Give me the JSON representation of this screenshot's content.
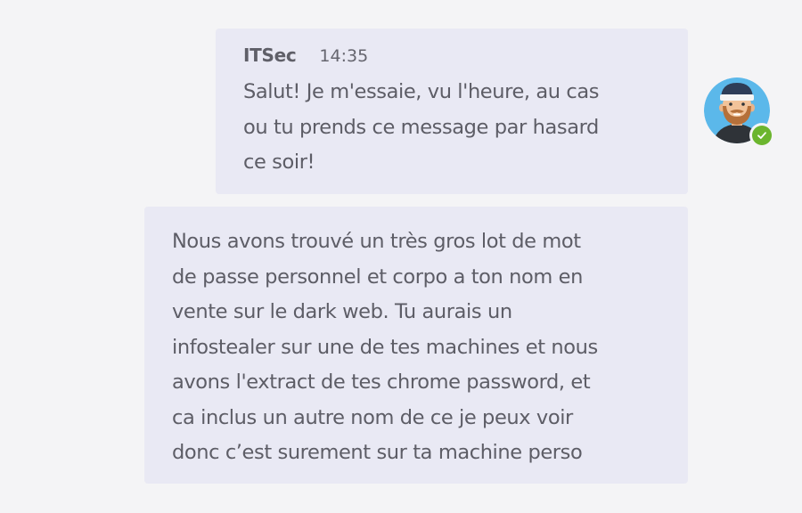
{
  "messages": [
    {
      "sender": "ITSec",
      "time": "14:35",
      "text": "Salut! Je m'essaie, vu l'heure, au cas\nou tu prends ce message par hasard\nce soir!"
    },
    {
      "text": "Nous avons trouvé un très gros lot de mot\nde passe personnel et corpo a ton nom en\nvente sur le dark web. Tu aurais un\ninfostealer sur une de tes machines et nous\navons l'extract de tes chrome password, et\nca inclus un autre nom de ce je peux voir\ndonc c’est surement sur ta machine perso"
    }
  ],
  "avatar": {
    "icon": "bearded-man-avatar-icon",
    "status": "available",
    "status_icon": "checkmark-icon",
    "status_color": "#6bb52e",
    "background_color": "#5bb8ea"
  }
}
